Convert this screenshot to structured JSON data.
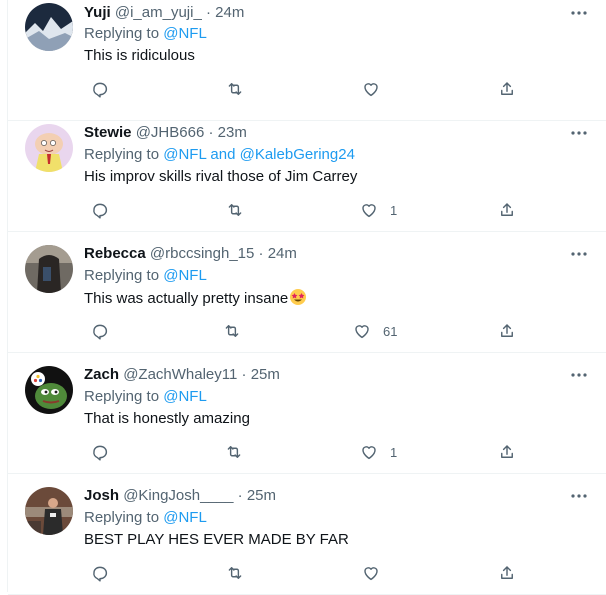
{
  "tweets": [
    {
      "name": "Yuji",
      "handle": "@i_am_yuji_",
      "dot": "·",
      "time": "24m",
      "replying": "Replying to",
      "mentions": [
        "@NFL"
      ],
      "text": "This is ridiculous",
      "likes": ""
    },
    {
      "name": "Stewie",
      "handle": "@JHB666",
      "dot": "·",
      "time": "23m",
      "replying": "Replying to",
      "mentions": [
        "@NFL",
        "and",
        "@KalebGering24"
      ],
      "text": "His improv skills rival those of Jim Carrey",
      "likes": "1"
    },
    {
      "name": "Rebecca",
      "handle": "@rbccsingh_15",
      "dot": "·",
      "time": "24m",
      "replying": "Replying to",
      "mentions": [
        "@NFL"
      ],
      "text": "This was actually pretty insane",
      "likes": "61"
    },
    {
      "name": "Zach",
      "handle": "@ZachWhaley11",
      "dot": "·",
      "time": "25m",
      "replying": "Replying to",
      "mentions": [
        "@NFL"
      ],
      "text": "That is honestly amazing",
      "likes": "1"
    },
    {
      "name": "Josh",
      "handle": "@KingJosh____",
      "dot": "·",
      "time": "25m",
      "replying": "Replying to",
      "mentions": [
        "@NFL"
      ],
      "text": "BEST PLAY HES EVER MADE BY FAR",
      "likes": ""
    }
  ],
  "icons": {
    "reply": "reply-icon",
    "retweet": "retweet-icon",
    "like": "like-icon",
    "share": "share-icon",
    "more": "more-icon"
  },
  "colors": {
    "link": "#1d9bf0",
    "secondary": "#536471",
    "text": "#0f1419"
  }
}
